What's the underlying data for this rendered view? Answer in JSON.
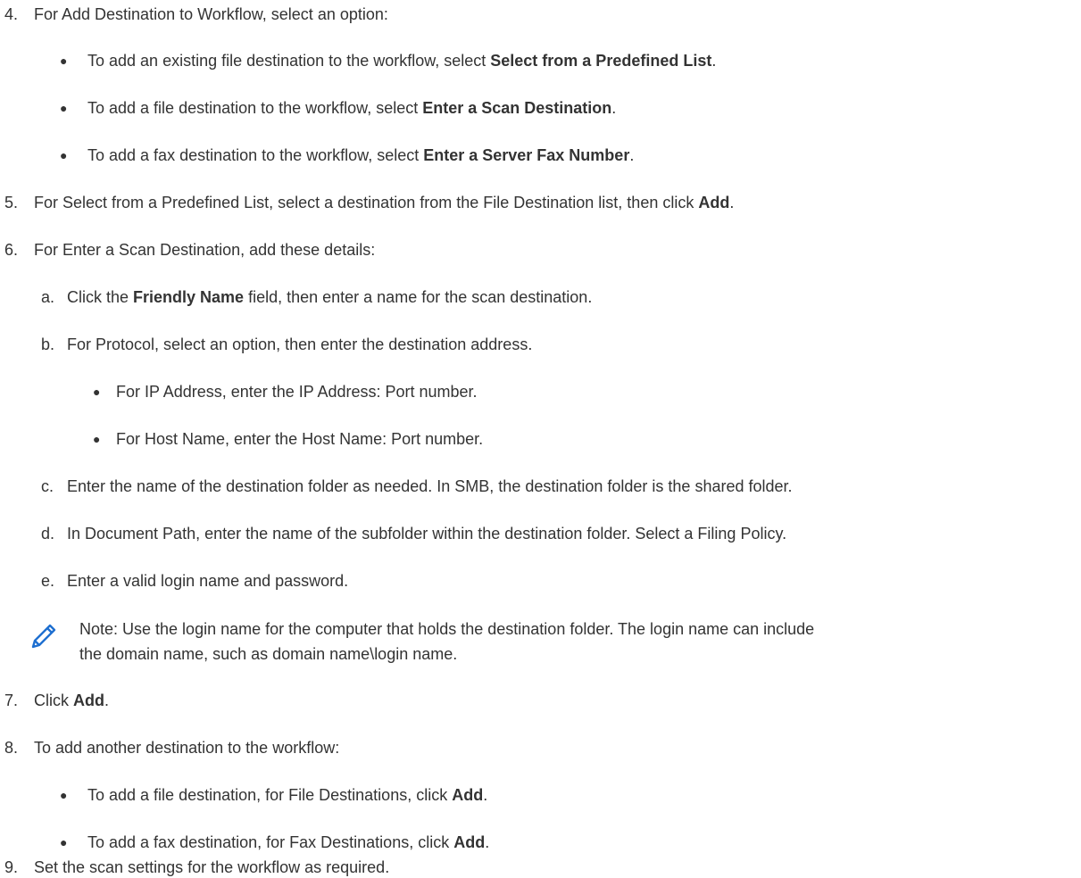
{
  "step4": {
    "num": "4.",
    "text": "For Add Destination to Workflow, select an option:",
    "bullets": [
      {
        "pre": "To add an existing file destination to the workflow, select ",
        "bold": "Select from a Predefined List",
        "post": "."
      },
      {
        "pre": "To add a file destination to the workflow, select ",
        "bold": "Enter a Scan Destination",
        "post": "."
      },
      {
        "pre": "To add a fax destination to the workflow, select ",
        "bold": "Enter a Server Fax Number",
        "post": "."
      }
    ]
  },
  "step5": {
    "num": "5.",
    "pre": "For Select from a Predefined List, select a destination from the File Destination list, then click ",
    "bold": "Add",
    "post": "."
  },
  "step6": {
    "num": "6.",
    "text": "For Enter a Scan Destination, add these details:",
    "sub_a": {
      "letter": "a.",
      "pre": "Click the ",
      "bold": "Friendly Name",
      "post": " field, then enter a name for the scan destination."
    },
    "sub_b": {
      "letter": "b.",
      "text": "For Protocol, select an option, then enter the destination address.",
      "bullets": [
        "For IP Address, enter the IP Address: Port number.",
        "For Host Name, enter the Host Name: Port number."
      ]
    },
    "sub_c": {
      "letter": "c.",
      "text": "Enter the name of the destination folder as needed. In SMB, the destination folder is the shared folder."
    },
    "sub_d": {
      "letter": "d.",
      "text": "In Document Path, enter the name of the subfolder within the destination folder. Select a Filing Policy."
    },
    "sub_e": {
      "letter": "e.",
      "text": "Enter a valid login name and password."
    }
  },
  "note": {
    "icon": "pencil-note-icon",
    "line1": "Note: Use the login name for the computer that holds the destination folder. The login name can include",
    "line2": "the domain name, such as domain name\\login name."
  },
  "step7": {
    "num": "7.",
    "pre": "Click ",
    "bold": "Add",
    "post": "."
  },
  "step8": {
    "num": "8.",
    "text": "To add another destination to the workflow:",
    "bullets": [
      {
        "pre": "To add a file destination, for File Destinations, click ",
        "bold": "Add",
        "post": "."
      },
      {
        "pre": "To add a fax destination, for Fax Destinations, click ",
        "bold": "Add",
        "post": "."
      }
    ]
  },
  "step9": {
    "num": "9.",
    "text": "Set the scan settings for the workflow as required."
  },
  "colors": {
    "text": "#333333",
    "icon": "#1e6fd0"
  }
}
